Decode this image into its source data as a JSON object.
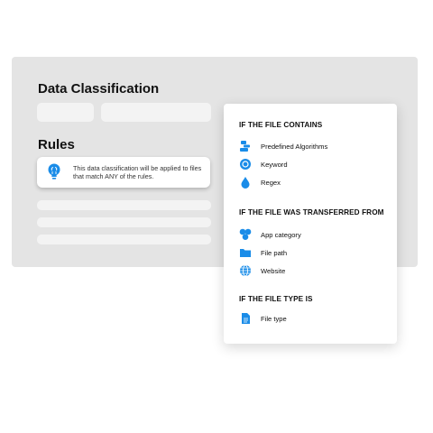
{
  "header": {
    "title": "Data Classification"
  },
  "rules": {
    "heading": "Rules",
    "note": "This data classification will be applied to files that match ANY of the rules."
  },
  "dropdown": {
    "sections": [
      {
        "title": "IF THE FILE CONTAINS",
        "items": [
          {
            "label": "Predefined Algorithms",
            "icon": "algorithms-icon"
          },
          {
            "label": "Keyword",
            "icon": "keyword-icon"
          },
          {
            "label": "Regex",
            "icon": "regex-icon"
          }
        ]
      },
      {
        "title": "IF THE FILE WAS TRANSFERRED FROM",
        "items": [
          {
            "label": "App category",
            "icon": "app-category-icon"
          },
          {
            "label": "File path",
            "icon": "folder-icon"
          },
          {
            "label": "Website",
            "icon": "globe-icon"
          }
        ]
      },
      {
        "title": "IF THE FILE TYPE IS",
        "items": [
          {
            "label": "File type",
            "icon": "file-icon"
          }
        ]
      }
    ]
  },
  "colors": {
    "accent": "#1a8ce8",
    "panel": "#e4e4e4",
    "placeholder": "#f3f3f3"
  }
}
